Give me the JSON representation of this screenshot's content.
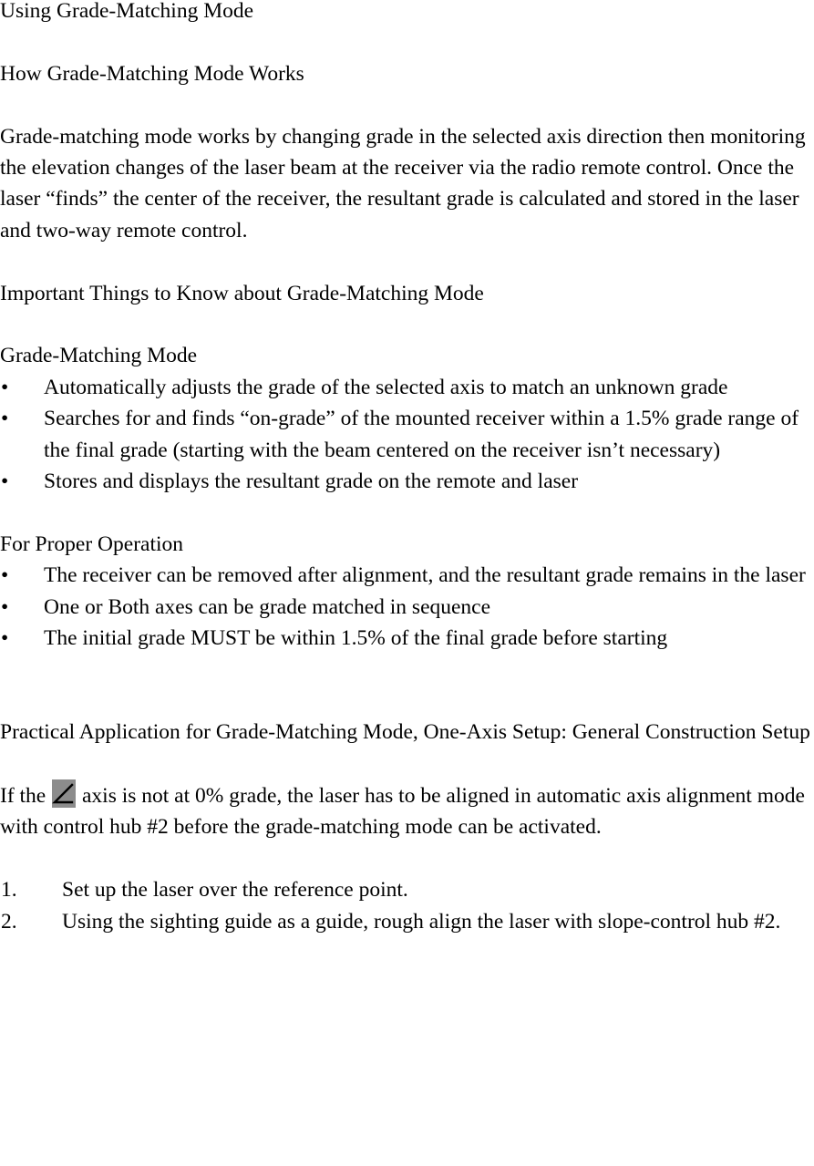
{
  "document": {
    "title": "Using Grade-Matching Mode",
    "sections": [
      {
        "heading": "How Grade-Matching Mode Works",
        "paragraph": "Grade-matching mode works by changing grade in the selected axis direction then monitoring the elevation changes of the laser beam at the receiver via the radio remote control. Once the laser “finds” the center of the receiver, the resultant grade is calculated and stored in the laser and two-way remote control."
      },
      {
        "heading": "Important Things to Know about Grade-Matching Mode",
        "subheading_1": "Grade-Matching Mode",
        "bullets_1": [
          "Automatically adjusts the grade of the selected axis to match an unknown grade",
          "Searches for and finds “on-grade” of the mounted receiver within a 1.5% grade range of the final grade (starting with the beam centered on the receiver isn’t necessary)",
          "Stores and displays the resultant grade on the remote and laser"
        ],
        "subheading_2": "For Proper Operation",
        "bullets_2": [
          "The receiver can be removed after alignment, and the resultant grade remains in the laser",
          "One or Both axes can be grade matched in sequence",
          "The initial grade MUST be within 1.5% of the final grade before starting"
        ]
      },
      {
        "heading": "Practical Application for Grade-Matching Mode, One-Axis Setup: General Construction Setup",
        "note_prefix": "If the ",
        "note_icon_label": "angle-axis-symbol",
        "note_suffix": " axis is not at 0% grade, the laser has to be aligned in automatic axis alignment mode with control hub #2 before the grade-matching mode can be activated.",
        "steps": [
          {
            "number": "1.",
            "text": "Set up the laser over the reference point."
          },
          {
            "number": "2.",
            "text": "Using the sighting guide as a guide, rough align the laser with slope-control hub #2."
          }
        ]
      }
    ],
    "bullet_marker": "•",
    "colors": {
      "text": "#000000",
      "background": "#ffffff",
      "glyph_background": "#8c8c8c",
      "glyph_stroke": "#000000"
    }
  }
}
